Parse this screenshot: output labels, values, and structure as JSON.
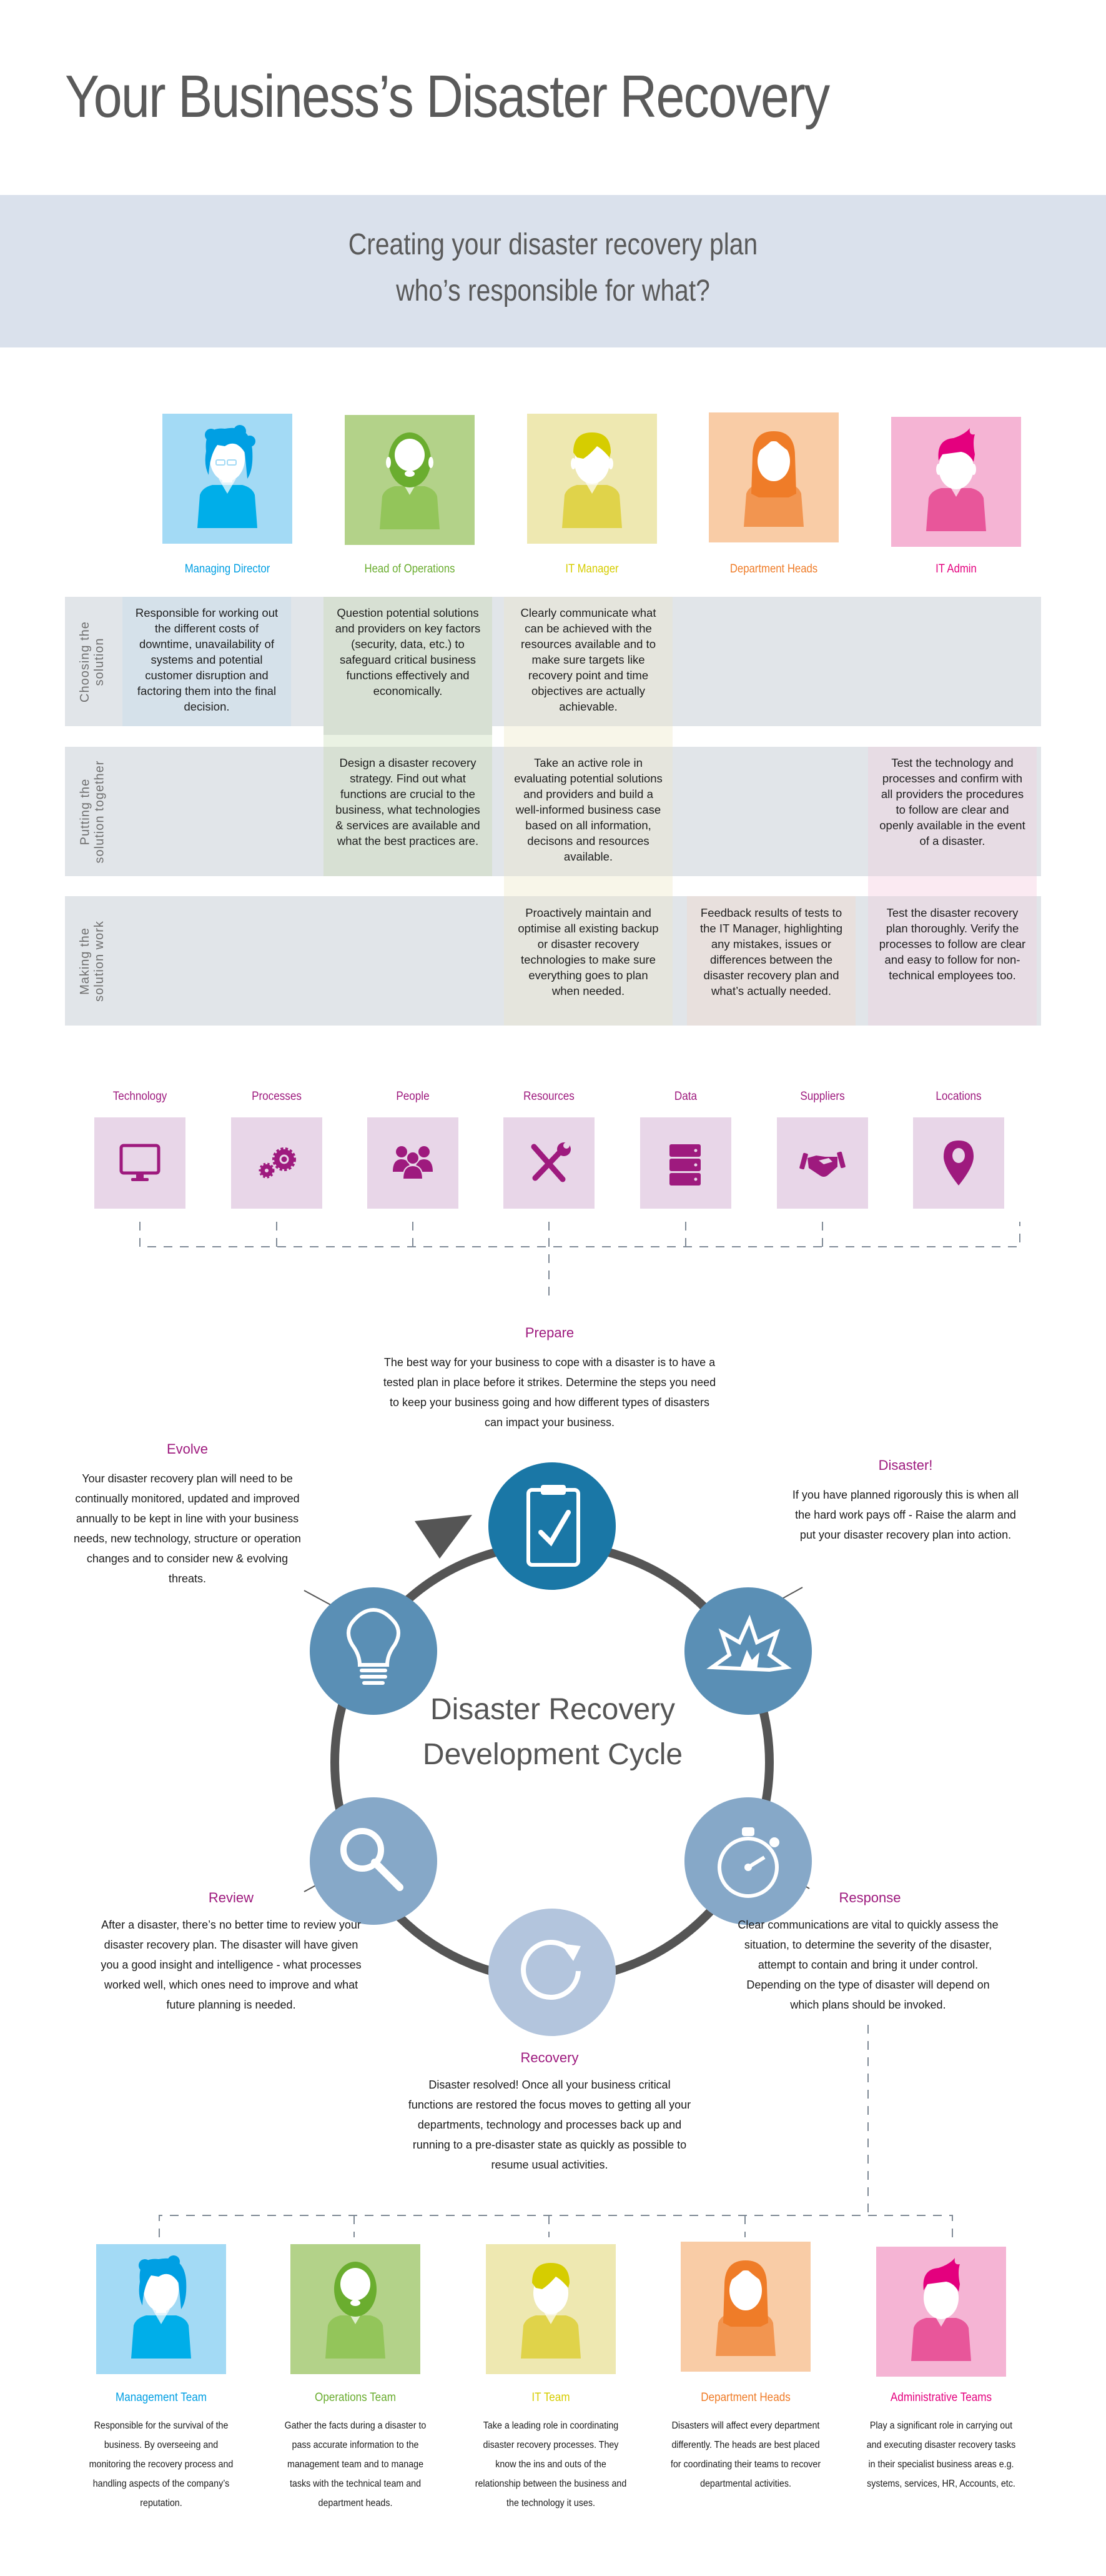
{
  "header": {
    "title": "Your Business’s Disaster Recovery",
    "banner_line1": "Creating your disaster recovery plan",
    "banner_line2": "who’s responsible for what?"
  },
  "colors": {
    "blue": "#009fe3",
    "green": "#6aad2f",
    "yellow": "#d6cd00",
    "orange": "#ef7c28",
    "pink": "#e4007e",
    "purple": "#9e1a7e",
    "cycle_dark": "#1a77a6",
    "cycle_mid": "#5a8fb5",
    "cycle_light": "#86a8c8",
    "cycle_pale": "#b3c5dd"
  },
  "roles": [
    {
      "label": "Managing Director",
      "avatar": "curly-hair-glasses-person-icon"
    },
    {
      "label": "Head of Operations",
      "avatar": "bearded-person-icon"
    },
    {
      "label": "IT Manager",
      "avatar": "side-parted-person-icon"
    },
    {
      "label": "Department Heads",
      "avatar": "long-hair-woman-icon"
    },
    {
      "label": "IT Admin",
      "avatar": "spiky-hair-person-icon"
    }
  ],
  "matrix": {
    "rows": [
      {
        "label": "Choosing the\nsolution",
        "cells": [
          "Responsible for working out the different costs of downtime, unavailability of systems and potential customer disruption and factoring them into the final decision.",
          "Question potential solutions and providers on key factors (security, data, etc.) to safeguard critical business functions effectively and economically.",
          "Clearly communicate what can be achieved with the resources available and to make sure targets like recovery point and time objectives are actually achievable.",
          "",
          ""
        ]
      },
      {
        "label": "Putting the\nsolution together",
        "cells": [
          "",
          "Design a disaster recovery strategy. Find out what functions are crucial to the business, what technologies & services are available and what the best practices are.",
          "Take an active role in evaluating potential solutions and providers and build a well-informed business case based on all information, decisons and resources available.",
          "",
          "Test the technology and processes and confirm with all providers the procedures to follow are clear and openly available in the event of a disaster."
        ]
      },
      {
        "label": "Making the\nsolution work",
        "cells": [
          "",
          "",
          "Proactively maintain and optimise all existing backup or disaster recovery technologies to make sure everything goes to plan when needed.",
          "Feedback results of tests to the IT Manager, highlighting any mistakes, issues or differences between the disaster recovery plan and what’s actually needed.",
          "Test the disaster recovery plan thoroughly. Verify the processes to follow are clear and easy to follow for non-technical employees too."
        ]
      }
    ]
  },
  "categories": [
    {
      "label": "Technology",
      "icon": "monitor-icon"
    },
    {
      "label": "Processes",
      "icon": "gears-icon"
    },
    {
      "label": "People",
      "icon": "people-group-icon"
    },
    {
      "label": "Resources",
      "icon": "tools-icon"
    },
    {
      "label": "Data",
      "icon": "server-icon"
    },
    {
      "label": "Suppliers",
      "icon": "handshake-icon"
    },
    {
      "label": "Locations",
      "icon": "map-pin-icon"
    }
  ],
  "cycle": {
    "title_line1": "Disaster Recovery",
    "title_line2": "Development Cycle",
    "phases": {
      "prepare": {
        "title": "Prepare",
        "text": "The best way for your business to cope with a disaster is to have a tested plan in place before it strikes. Determine the steps you need to keep your business going and how different types of disasters can impact your business."
      },
      "disaster": {
        "title": "Disaster!",
        "text": "If you have planned rigorously this is when all the hard work pays off - Raise the alarm and put your disaster recovery plan into action."
      },
      "response": {
        "title": "Response",
        "text": "Clear communications are vital to quickly assess the situation, to determine the severity of the disaster, attempt to contain and bring it under control. Depending on the type of disaster will depend on which plans should be invoked."
      },
      "recovery": {
        "title": "Recovery",
        "text": "Disaster resolved! Once all your business critical functions are restored the focus moves to getting all your departments, technology and processes back up and running to a pre-disaster state as quickly as possible to resume usual activities."
      },
      "review": {
        "title": "Review",
        "text": "After a disaster, there’s no better time to review your disaster recovery plan. The disaster will have given you a good insight and intelligence - what processes worked well, which ones need to improve and what future planning is needed."
      },
      "evolve": {
        "title": "Evolve",
        "text": "Your disaster recovery plan will need to be continually monitored, updated and improved annually to be kept in line with your business needs, new technology, structure or operation changes and to consider new & evolving threats."
      }
    }
  },
  "teams": [
    {
      "label": "Management Team",
      "text": "Responsible for the survival of the business. By overseeing and monitoring the recovery process and handling aspects of the company’s reputation."
    },
    {
      "label": "Operations Team",
      "text": "Gather the facts during a disaster to pass accurate information to the management team and to manage tasks with the technical team and department heads."
    },
    {
      "label": "IT Team",
      "text": "Take a leading role in coordinating disaster recovery processes. They know the ins and outs of the relationship between the business and the technology it uses."
    },
    {
      "label": "Department Heads",
      "text": "Disasters will affect every department differently. The heads are best placed for coordinating their teams to recover departmental activities."
    },
    {
      "label": "Administrative Teams",
      "text": "Play a significant role in carrying out and executing disaster recovery tasks in their specialist business areas e.g. systems, services, HR, Accounts, etc."
    }
  ]
}
